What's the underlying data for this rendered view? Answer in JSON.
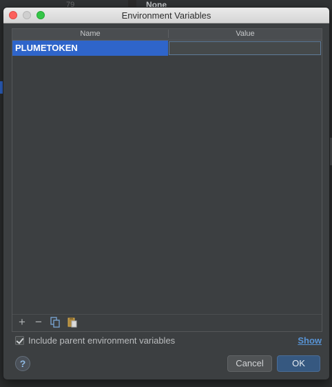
{
  "background": {
    "line_number": "79",
    "code_text": "None"
  },
  "dialog": {
    "title": "Environment Variables",
    "table": {
      "columns": [
        "Name",
        "Value"
      ],
      "rows": [
        {
          "name": "PLUMETOKEN",
          "value": ""
        }
      ]
    },
    "toolbar": {
      "add": "+",
      "remove": "−",
      "copy_icon": "copy-icon",
      "paste_icon": "paste-icon"
    },
    "include_parent": {
      "label": "Include parent environment variables",
      "checked": true
    },
    "show_link": "Show",
    "help_label": "?",
    "cancel_label": "Cancel",
    "ok_label": "OK"
  },
  "colors": {
    "selection": "#2f65ca",
    "link": "#5894d6",
    "ok_button": "#365880"
  }
}
